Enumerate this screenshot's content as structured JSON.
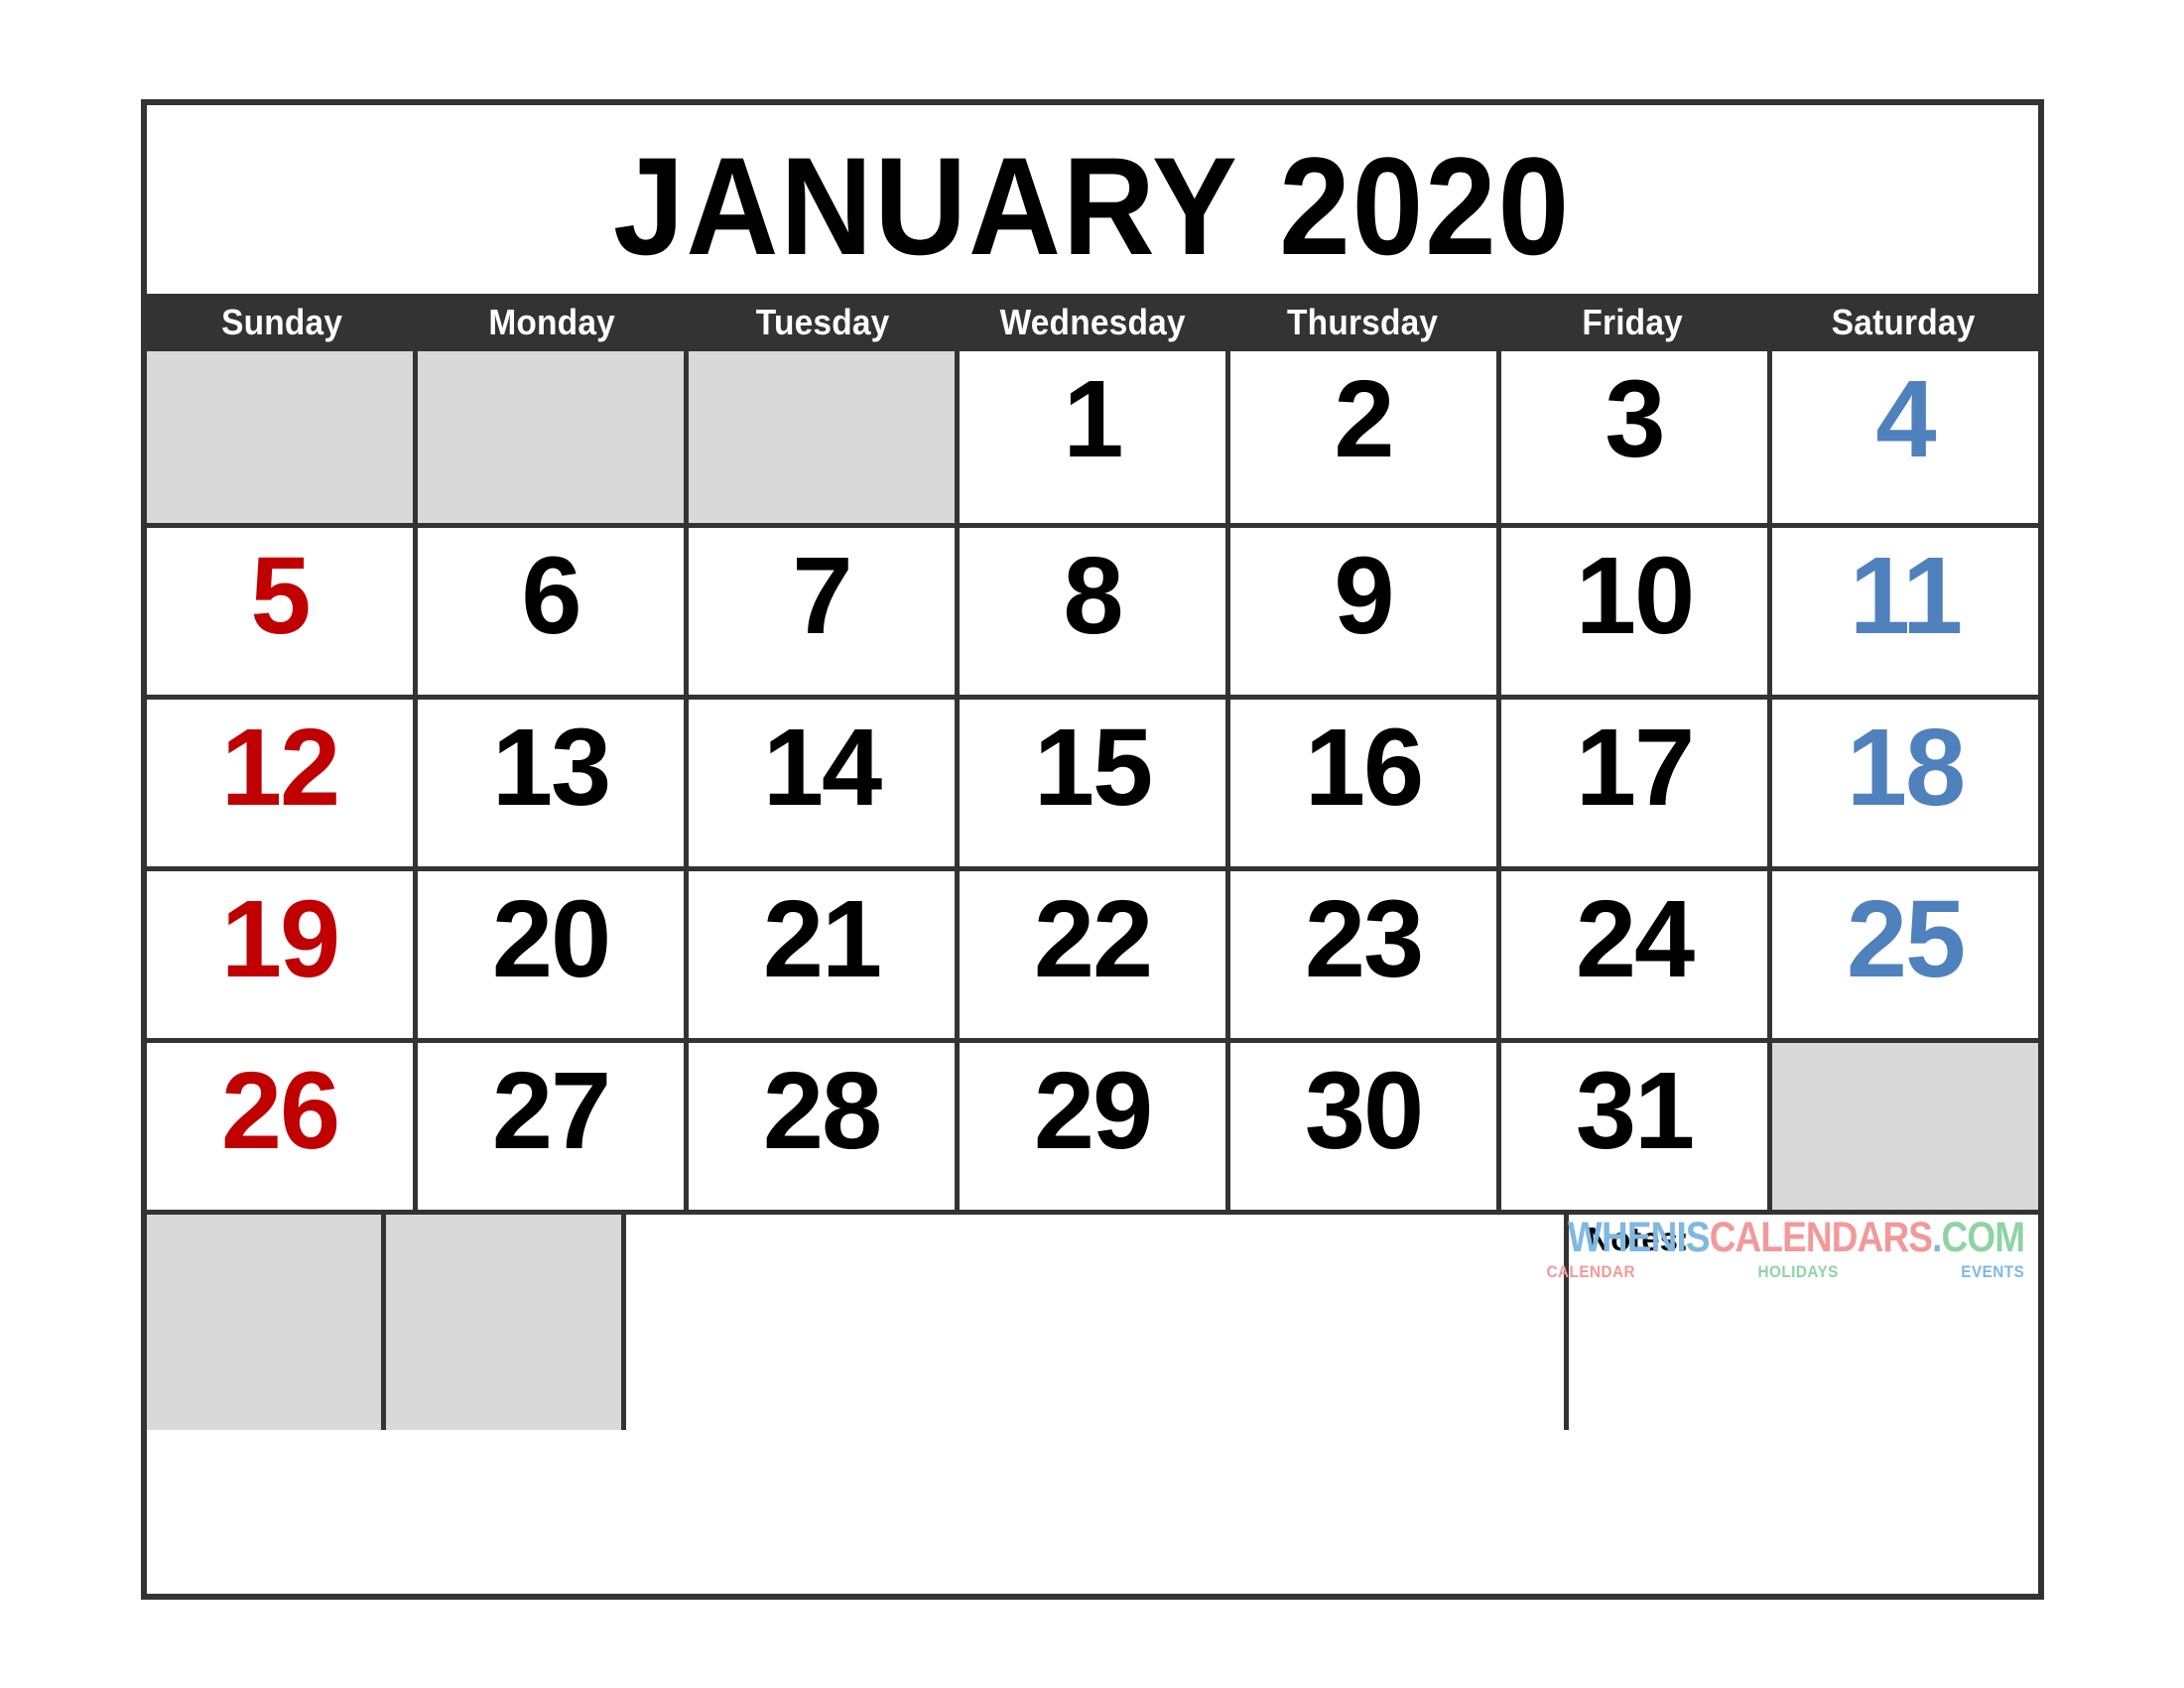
{
  "calendar": {
    "title": {
      "month": "JANUARY",
      "year": "2020",
      "full": "JANUARY 2020"
    },
    "weekdays": [
      "Sunday",
      "Monday",
      "Tuesday",
      "Wednesday",
      "Thursday",
      "Friday",
      "Saturday"
    ],
    "weeks": [
      [
        {
          "day": "",
          "blank": true,
          "kind": "weekday"
        },
        {
          "day": "",
          "blank": true,
          "kind": "weekday"
        },
        {
          "day": "",
          "blank": true,
          "kind": "weekday"
        },
        {
          "day": "1",
          "blank": false,
          "kind": "weekday"
        },
        {
          "day": "2",
          "blank": false,
          "kind": "weekday"
        },
        {
          "day": "3",
          "blank": false,
          "kind": "weekday"
        },
        {
          "day": "4",
          "blank": false,
          "kind": "saturday"
        }
      ],
      [
        {
          "day": "5",
          "blank": false,
          "kind": "sunday"
        },
        {
          "day": "6",
          "blank": false,
          "kind": "weekday"
        },
        {
          "day": "7",
          "blank": false,
          "kind": "weekday"
        },
        {
          "day": "8",
          "blank": false,
          "kind": "weekday"
        },
        {
          "day": "9",
          "blank": false,
          "kind": "weekday"
        },
        {
          "day": "10",
          "blank": false,
          "kind": "weekday"
        },
        {
          "day": "11",
          "blank": false,
          "kind": "saturday"
        }
      ],
      [
        {
          "day": "12",
          "blank": false,
          "kind": "sunday"
        },
        {
          "day": "13",
          "blank": false,
          "kind": "weekday"
        },
        {
          "day": "14",
          "blank": false,
          "kind": "weekday"
        },
        {
          "day": "15",
          "blank": false,
          "kind": "weekday"
        },
        {
          "day": "16",
          "blank": false,
          "kind": "weekday"
        },
        {
          "day": "17",
          "blank": false,
          "kind": "weekday"
        },
        {
          "day": "18",
          "blank": false,
          "kind": "saturday"
        }
      ],
      [
        {
          "day": "19",
          "blank": false,
          "kind": "sunday"
        },
        {
          "day": "20",
          "blank": false,
          "kind": "weekday"
        },
        {
          "day": "21",
          "blank": false,
          "kind": "weekday"
        },
        {
          "day": "22",
          "blank": false,
          "kind": "weekday"
        },
        {
          "day": "23",
          "blank": false,
          "kind": "weekday"
        },
        {
          "day": "24",
          "blank": false,
          "kind": "weekday"
        },
        {
          "day": "25",
          "blank": false,
          "kind": "saturday"
        }
      ],
      [
        {
          "day": "26",
          "blank": false,
          "kind": "sunday"
        },
        {
          "day": "27",
          "blank": false,
          "kind": "weekday"
        },
        {
          "day": "28",
          "blank": false,
          "kind": "weekday"
        },
        {
          "day": "29",
          "blank": false,
          "kind": "weekday"
        },
        {
          "day": "30",
          "blank": false,
          "kind": "weekday"
        },
        {
          "day": "31",
          "blank": false,
          "kind": "weekday"
        },
        {
          "day": "",
          "blank": true,
          "kind": "saturday"
        }
      ]
    ],
    "notes": {
      "label": "Notes:",
      "value": ""
    },
    "watermark": {
      "part1": "WHENIS",
      "part2": "CALENDARS",
      "part3": ".",
      "part4": "COM",
      "sub1": "CALENDAR",
      "sub2": "HOLIDAYS",
      "sub3": "EVENTS"
    },
    "colors": {
      "header_bg": "#333333",
      "border": "#333333",
      "blank_cell": "#d9d9d9",
      "sunday": "#c00000",
      "saturday": "#4f81bd",
      "weekday": "#000000",
      "logo_blue": "#7fb8e0",
      "logo_pink": "#f2999a",
      "logo_green": "#8fd3a4"
    }
  }
}
